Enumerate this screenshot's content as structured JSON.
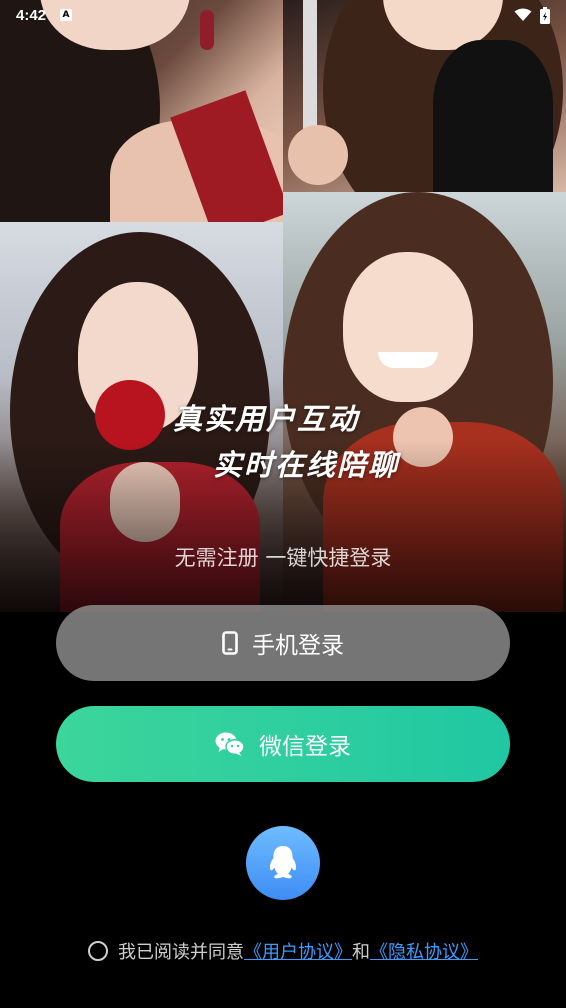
{
  "status_bar": {
    "time": "4:42",
    "icons": [
      "a-notification-icon",
      "wifi-icon",
      "battery-icon"
    ]
  },
  "slogan": {
    "line1": "真实用户互动",
    "line2": "实时在线陪聊"
  },
  "subtitle": "无需注册 一键快捷登录",
  "buttons": {
    "phone_login": "手机登录",
    "wechat_login": "微信登录"
  },
  "agreement": {
    "prefix": "我已阅读并同意",
    "user_agreement": "《用户协议》",
    "conjunction": "和",
    "privacy_agreement": "《隐私协议》",
    "checked": false
  },
  "colors": {
    "wechat_gradient_start": "#3cd59b",
    "wechat_gradient_end": "#20c7a2",
    "qq_blue": "#3d8df5",
    "link_blue": "#3c9cff",
    "phone_button_gray": "#969696"
  }
}
